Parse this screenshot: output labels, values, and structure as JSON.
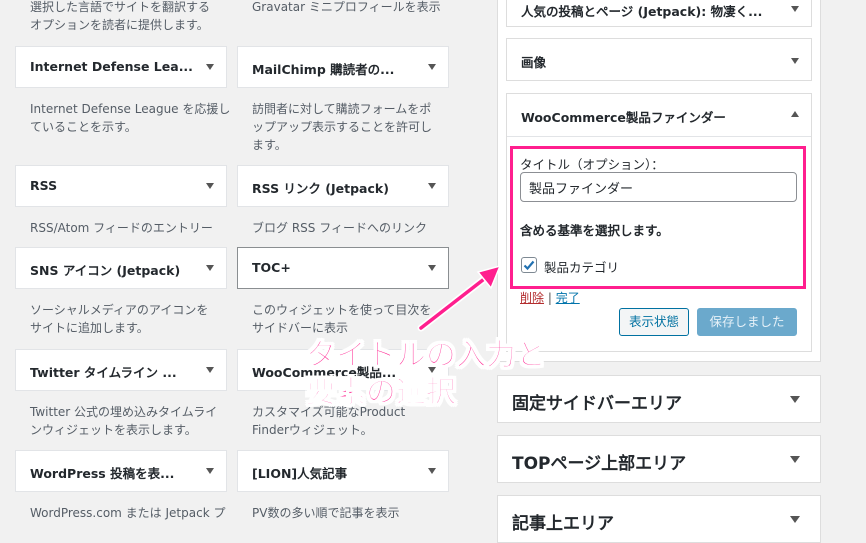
{
  "left_col": {
    "top_desc": "選択した言語でサイトを翻訳する\nオプションを読者に提供します。",
    "widgets": [
      {
        "label": "Internet Defense Lea...",
        "desc": "Internet Defense League を応援し\nていることを示す。"
      },
      {
        "label": "RSS",
        "desc": "RSS/Atom フィードのエントリー"
      },
      {
        "label": "SNS アイコン (Jetpack)",
        "desc": "ソーシャルメディアのアイコンを\nサイトに追加します。"
      },
      {
        "label": "Twitter タイムライン ...",
        "desc": "Twitter 公式の埋め込みタイムライ\nンウィジェットを表示します。"
      },
      {
        "label": "WordPress 投稿を表...",
        "desc": "WordPress.com または Jetpack プ"
      }
    ]
  },
  "mid_col": {
    "top_desc": "Gravatar ミニプロフィールを表示",
    "widgets": [
      {
        "label": "MailChimp 購読者の...",
        "desc": "訪問者に対して購読フォームをポ\nップアップ表示することを許可し\nます。"
      },
      {
        "label": "RSS リンク (Jetpack)",
        "desc": "ブログ RSS フィードへのリンク"
      },
      {
        "label": "TOC+",
        "desc": "このウィジェットを使って目次を\nサイドバーに表示"
      },
      {
        "label": "WooCommerce製品...",
        "desc": "カスタマイズ可能なProduct\nFinderウィジェット。"
      },
      {
        "label": "[LION]人気記事",
        "desc": "PV数の多い順で記事を表示"
      }
    ]
  },
  "right_panel": {
    "item_top": "人気の投稿とページ (Jetpack): 物凄く...",
    "item_image": "画像",
    "woo_header": "WooCommerce製品ファインダー",
    "title_label": "タイトル（オプション）：",
    "title_value": "製品ファインダー",
    "criteria_label": "含める基準を選択します。",
    "checkbox_label": "製品カテゴリ",
    "delete_link": "削除",
    "separator": "|",
    "done_link": "完了",
    "visibility_button": "表示状態",
    "saved_button": "保存しました"
  },
  "areas": [
    {
      "label": "固定サイドバーエリア"
    },
    {
      "label": "TOPページ上部エリア"
    },
    {
      "label": "記事上エリア"
    }
  ],
  "annotation": {
    "line1": "タイトルの入力と",
    "line2": "要素の選択",
    "color": "#ff1f8e"
  }
}
